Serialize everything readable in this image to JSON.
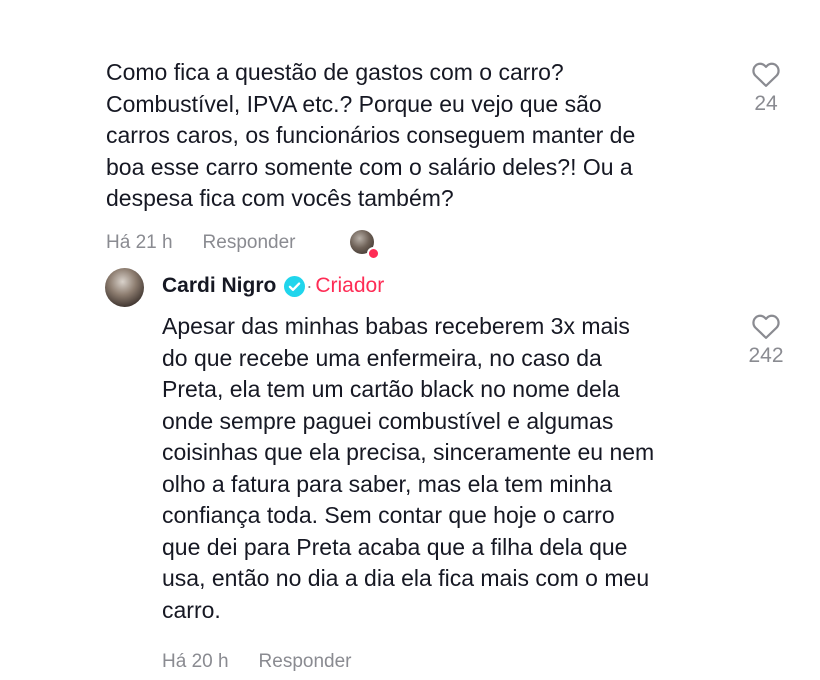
{
  "comment1": {
    "text": "Como fica a questão de gastos com o carro?\nCombustível, IPVA etc.? Porque eu vejo que são\ncarros caros, os funcionários conseguem manter de\nboa esse carro somente com o salário deles?! Ou a\ndespesa fica com vocês também?",
    "time": "Há 21 h",
    "reply_label": "Responder",
    "like_count": "24",
    "like_icon": "heart-outline-icon",
    "liked_by_creator_icon": "creator-liked-avatar"
  },
  "comment2": {
    "author": "Cardi Nigro",
    "verified_icon": "verified-check-icon",
    "separator": "·",
    "role_badge": "Criador",
    "text": "Apesar das minhas babas receberem 3x mais\ndo que recebe uma enfermeira, no caso da\nPreta, ela tem um cartão black no nome dela\nonde sempre paguei combustível e algumas\ncoisinhas que ela precisa, sinceramente eu nem\nolho a fatura para saber, mas ela tem minha\nconfiança toda. Sem contar que hoje o carro\nque dei para Preta acaba que a filha dela que\nusa, então no dia a dia ela fica mais com o meu\ncarro.",
    "time": "Há 20 h",
    "reply_label": "Responder",
    "like_count": "242",
    "like_icon": "heart-outline-icon"
  },
  "colors": {
    "text": "#161823",
    "secondary": "#8a8b91",
    "accent": "#fe2c55",
    "verified": "#20d5ec"
  }
}
